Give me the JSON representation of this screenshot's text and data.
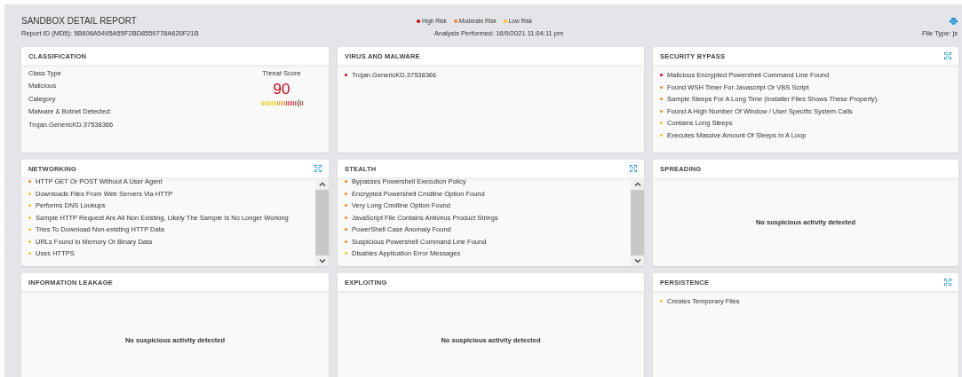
{
  "header": {
    "title": "SANDBOX DETAIL REPORT",
    "report_id": "Report ID (MD5): 5B606A5495A55F2BD8559778A620F21B",
    "legend": [
      {
        "label": "High Risk",
        "color": "#d0021b"
      },
      {
        "label": "Moderate Risk",
        "color": "#f5841f"
      },
      {
        "label": "Low Risk",
        "color": "#f5c518"
      }
    ],
    "analysis": "Analysis Performed: 16/9/2021 11:04:11 pm",
    "file_type": "File Type: js"
  },
  "cards": [
    {
      "kind": "classification",
      "title": "CLASSIFICATION",
      "expandable": false,
      "class_type_label": "Class Type",
      "class_type": "Malicious",
      "category_label": "Category",
      "category": "Malware & Botnet Detected:",
      "detection": "Trojan.GenericKD.37538366",
      "score_label": "Threat Score",
      "score": "90",
      "level": 0.9
    },
    {
      "kind": "list",
      "title": "VIRUS AND MALWARE",
      "expandable": false,
      "scrollable": false,
      "items": [
        {
          "text": "Trojan.GenericKD.37538366",
          "color": "#d0021b"
        }
      ]
    },
    {
      "kind": "list",
      "title": "SECURITY BYPASS",
      "expandable": true,
      "scrollable": false,
      "items": [
        {
          "text": "Malicious Encrypted Powershell Command Line Found",
          "color": "#d0021b"
        },
        {
          "text": "Found WSH Timer For Javascript Or VBS Script",
          "color": "#f5841f"
        },
        {
          "text": "Sample Sleeps For A Long Time (Installer Files Shows These Property).",
          "color": "#f5841f"
        },
        {
          "text": "Found A High Number Of Window / User Specific System Calls",
          "color": "#f5841f"
        },
        {
          "text": "Contains Long Sleeps",
          "color": "#f5c518"
        },
        {
          "text": "Executes Massive Amount Of Sleeps In A Loop",
          "color": "#f5c518"
        }
      ]
    },
    {
      "kind": "list",
      "title": "NETWORKING",
      "expandable": true,
      "scrollable": true,
      "items": [
        {
          "text": "HTTP GET Or POST Without A User Agent",
          "color": "#f5841f"
        },
        {
          "text": "Downloads Files From Web Servers Via HTTP",
          "color": "#f5c518"
        },
        {
          "text": "Performs DNS Lookups",
          "color": "#f5c518"
        },
        {
          "text": "Sample HTTP Request Are All Non Existing, Likely The Sample Is No Longer Working",
          "color": "#f5c518"
        },
        {
          "text": "Tries To Download Non-existing HTTP Data",
          "color": "#f5c518"
        },
        {
          "text": "URLs Found In Memory Or Binary Data",
          "color": "#f5c518"
        },
        {
          "text": "Uses HTTPS",
          "color": "#f5c518"
        }
      ]
    },
    {
      "kind": "list",
      "title": "STEALTH",
      "expandable": true,
      "scrollable": true,
      "items": [
        {
          "text": "Bypasses Powershell Execution Policy",
          "color": "#f5841f"
        },
        {
          "text": "Encrypted Powershell Cmdline Option Found",
          "color": "#f5841f"
        },
        {
          "text": "Very Long Cmdline Option Found",
          "color": "#f5841f"
        },
        {
          "text": "JavaScript File Contains Antivirus Product Strings",
          "color": "#f5841f"
        },
        {
          "text": "PowerShell Case Anomaly Found",
          "color": "#f5841f"
        },
        {
          "text": "Suspicious Powershell Command Line Found",
          "color": "#f5841f"
        },
        {
          "text": "Disables Application Error Messages",
          "color": "#f5c518"
        }
      ]
    },
    {
      "kind": "empty",
      "title": "SPREADING",
      "expandable": false,
      "message": "No suspicious activity detected"
    },
    {
      "kind": "empty",
      "title": "INFORMATION LEAKAGE",
      "expandable": false,
      "message": "No suspicious activity detected"
    },
    {
      "kind": "empty",
      "title": "EXPLOITING",
      "expandable": false,
      "message": "No suspicious activity detected"
    },
    {
      "kind": "list",
      "title": "PERSISTENCE",
      "expandable": true,
      "scrollable": false,
      "items": [
        {
          "text": "Creates Temporary Files",
          "color": "#f5c518"
        }
      ]
    }
  ]
}
